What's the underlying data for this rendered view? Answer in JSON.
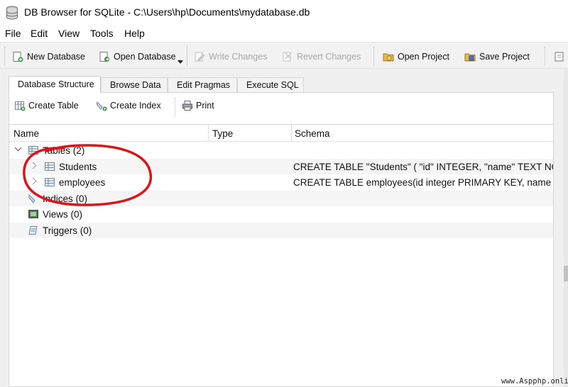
{
  "window": {
    "title": "DB Browser for SQLite - C:\\Users\\hp\\Documents\\mydatabase.db"
  },
  "menu": {
    "file": "File",
    "edit": "Edit",
    "view": "View",
    "tools": "Tools",
    "help": "Help"
  },
  "toolbar": {
    "new_database": "New Database",
    "open_database": "Open Database",
    "write_changes": "Write Changes",
    "revert_changes": "Revert Changes",
    "open_project": "Open Project",
    "save_project": "Save Project"
  },
  "tabs": [
    "Database Structure",
    "Browse Data",
    "Edit Pragmas",
    "Execute SQL"
  ],
  "structure_toolbar": {
    "create_table": "Create Table",
    "create_index": "Create Index",
    "print": "Print"
  },
  "tree": {
    "columns": [
      "Name",
      "Type",
      "Schema"
    ],
    "rows": [
      {
        "name": "Tables (2)",
        "type": "",
        "schema": ""
      },
      {
        "name": "Students",
        "type": "",
        "schema": "CREATE TABLE \"Students\" ( \"id\" INTEGER, \"name\" TEXT NOT"
      },
      {
        "name": "employees",
        "type": "",
        "schema": "CREATE TABLE employees(id integer PRIMARY KEY, name te"
      },
      {
        "name": "Indices (0)",
        "type": "",
        "schema": ""
      },
      {
        "name": "Views (0)",
        "type": "",
        "schema": ""
      },
      {
        "name": "Triggers (0)",
        "type": "",
        "schema": ""
      }
    ]
  },
  "colors": {
    "annotation": "#d8161c",
    "toolbar_bg": "#f2f2f2",
    "alt_row": "#f5f5f5"
  },
  "watermark": "www.Aspphp.online"
}
